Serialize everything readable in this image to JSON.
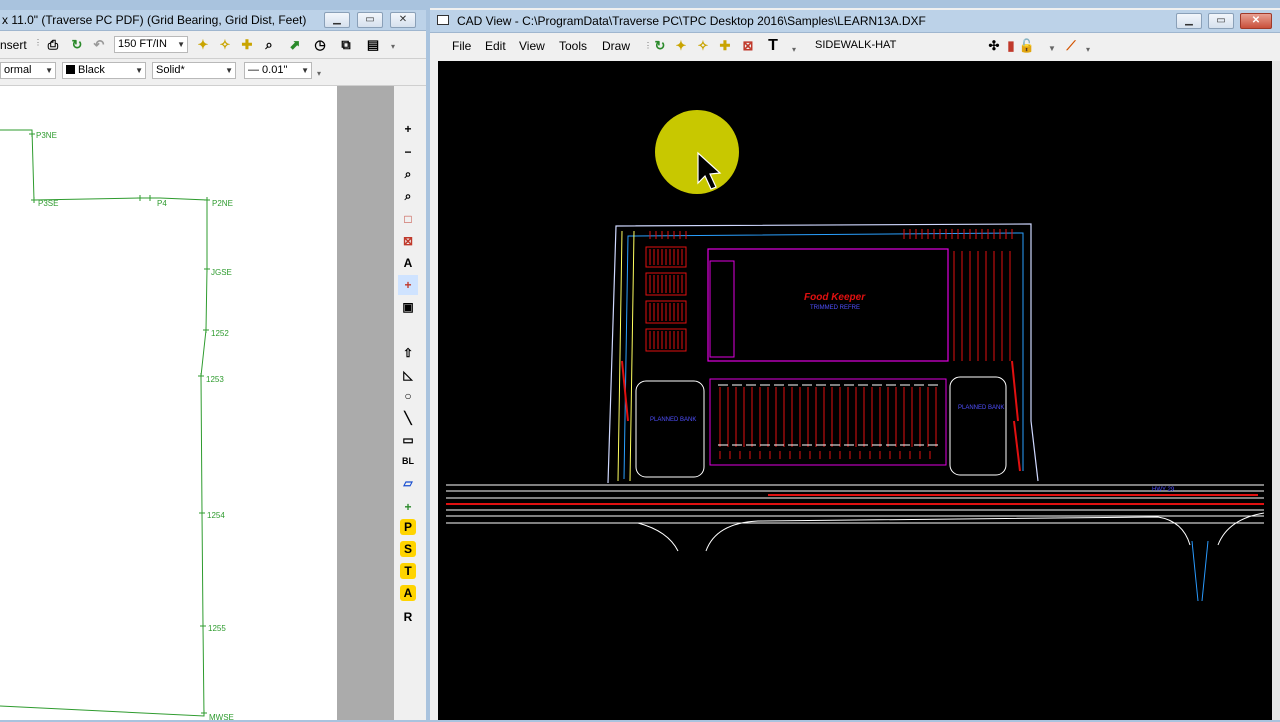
{
  "left_window": {
    "title": "x 11.0\" (Traverse PC PDF) (Grid Bearing, Grid Dist, Feet)",
    "toolbar1": {
      "insert_label": "nsert",
      "scale_value": "150 FT/IN"
    },
    "toolbar2": {
      "mode_value": "ormal",
      "color_value": "Black",
      "linetype_value": "Solid*",
      "lineweight_value": "— 0.01\""
    },
    "points": [
      "P3NE",
      "P3SE",
      "P4",
      "P2NE",
      "JGSE",
      "1252",
      "1253",
      "1254",
      "1255",
      "MWSE"
    ]
  },
  "cad_window": {
    "title": "CAD View - C:\\ProgramData\\Traverse PC\\TPC Desktop 2016\\Samples\\LEARN13A.DXF",
    "menu": [
      "File",
      "Edit",
      "View",
      "Tools",
      "Draw"
    ],
    "layer_value": "SIDEWALK-HAT"
  },
  "side_tools": [
    {
      "name": "zoom-in-icon",
      "glyph": "+"
    },
    {
      "name": "zoom-out-icon",
      "glyph": "−"
    },
    {
      "name": "zoom-window-icon",
      "glyph": "⌕"
    },
    {
      "name": "zoom-previous-icon",
      "glyph": "⌕"
    },
    {
      "name": "zoom-extents-icon",
      "glyph": "□"
    },
    {
      "name": "zoom-all-icon",
      "glyph": "⊠"
    },
    {
      "name": "text-tool-icon",
      "glyph": "A"
    },
    {
      "name": "crosshair-icon",
      "glyph": "+"
    },
    {
      "name": "printer-icon",
      "glyph": "▣"
    },
    {
      "name": "arrow-up-icon",
      "glyph": "⇧"
    },
    {
      "name": "triangle-icon",
      "glyph": "◺"
    },
    {
      "name": "circle-tool-icon",
      "glyph": "○"
    },
    {
      "name": "line-tool-icon",
      "glyph": "╲"
    },
    {
      "name": "rectangle-tool-icon",
      "glyph": "▭"
    },
    {
      "name": "bl-tool-icon",
      "glyph": "BL"
    },
    {
      "name": "polygon-tool-icon",
      "glyph": "▱"
    },
    {
      "name": "add-point-icon",
      "glyph": "+"
    },
    {
      "name": "p-tool-icon",
      "glyph": "P"
    },
    {
      "name": "s-tool-icon",
      "glyph": "S"
    },
    {
      "name": "t-tool-icon",
      "glyph": "T"
    },
    {
      "name": "a-tool-icon",
      "glyph": "A"
    },
    {
      "name": "r-tool-icon",
      "glyph": "R"
    }
  ],
  "cad_labels": {
    "store_name": "Food Keeper",
    "store_sub": "TRIMMED REFRE",
    "pad_left": "PLANNED BANK",
    "pad_right": "PLANNED BANK",
    "road_right": "HWY 29"
  },
  "colors": {
    "titlebar": "#bcd2e8",
    "desktop": "#a9c3de",
    "cad_bg": "#000000",
    "traverse_line": "#2e9b2e",
    "cursor_highlight": "#c8c800"
  }
}
